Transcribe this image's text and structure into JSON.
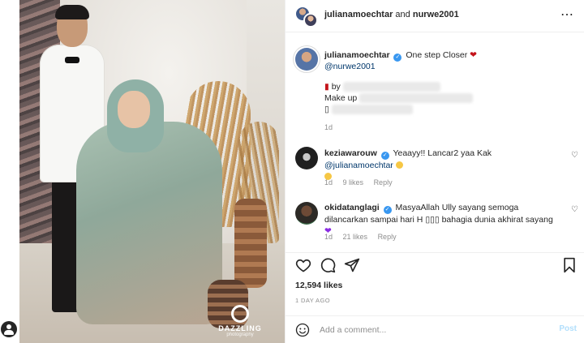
{
  "header": {
    "user1": "julianamoechtar",
    "joiner": "and",
    "user2": "nurwe2001"
  },
  "caption": {
    "username": "julianamoechtar",
    "text": "One step Closer",
    "mention": "@nurwe2001",
    "line1_prefix": "by",
    "line2_prefix": "Make up",
    "time": "1d"
  },
  "comments": [
    {
      "username": "keziawarouw",
      "text": "Yeaayy!! Lancar2 yaa Kak",
      "mention": "@julianamoechtar",
      "time": "1d",
      "likes": "9 likes",
      "reply": "Reply"
    },
    {
      "username": "okidatanglagi",
      "text": "MasyaAllah Ully sayang semoga dilancarkan sampai hari H",
      "text2": "bahagia dunia akhirat sayang",
      "time": "1d",
      "likes": "21 likes",
      "reply": "Reply"
    }
  ],
  "post": {
    "likes": "12,594 likes",
    "date": "1 DAY AGO"
  },
  "add_comment": {
    "placeholder": "Add a comment...",
    "post_label": "Post"
  },
  "watermark": {
    "brand": "DAZZLING",
    "sub": "photography"
  },
  "colors": {
    "verified": "#3897f0",
    "link": "#00376b",
    "muted": "#8e8e8e",
    "post_disabled": "#b2dffc"
  },
  "icons": [
    "more-icon",
    "heart-icon",
    "comment-icon",
    "share-icon",
    "bookmark-icon",
    "smile-icon",
    "verified-badge",
    "user-icon"
  ]
}
